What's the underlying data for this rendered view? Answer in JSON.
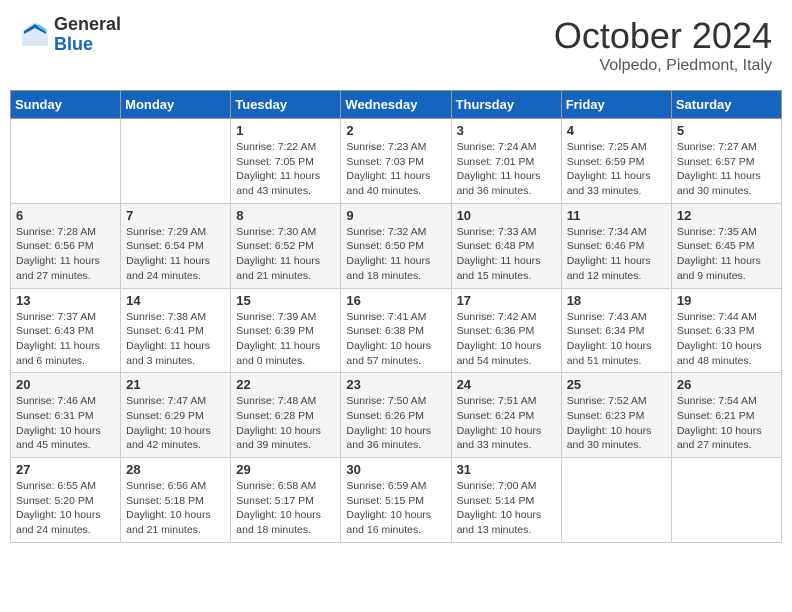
{
  "header": {
    "logo_general": "General",
    "logo_blue": "Blue",
    "month_title": "October 2024",
    "location": "Volpedo, Piedmont, Italy"
  },
  "calendar": {
    "days_of_week": [
      "Sunday",
      "Monday",
      "Tuesday",
      "Wednesday",
      "Thursday",
      "Friday",
      "Saturday"
    ],
    "weeks": [
      [
        {
          "day": "",
          "info": ""
        },
        {
          "day": "",
          "info": ""
        },
        {
          "day": "1",
          "info": "Sunrise: 7:22 AM\nSunset: 7:05 PM\nDaylight: 11 hours and 43 minutes."
        },
        {
          "day": "2",
          "info": "Sunrise: 7:23 AM\nSunset: 7:03 PM\nDaylight: 11 hours and 40 minutes."
        },
        {
          "day": "3",
          "info": "Sunrise: 7:24 AM\nSunset: 7:01 PM\nDaylight: 11 hours and 36 minutes."
        },
        {
          "day": "4",
          "info": "Sunrise: 7:25 AM\nSunset: 6:59 PM\nDaylight: 11 hours and 33 minutes."
        },
        {
          "day": "5",
          "info": "Sunrise: 7:27 AM\nSunset: 6:57 PM\nDaylight: 11 hours and 30 minutes."
        }
      ],
      [
        {
          "day": "6",
          "info": "Sunrise: 7:28 AM\nSunset: 6:56 PM\nDaylight: 11 hours and 27 minutes."
        },
        {
          "day": "7",
          "info": "Sunrise: 7:29 AM\nSunset: 6:54 PM\nDaylight: 11 hours and 24 minutes."
        },
        {
          "day": "8",
          "info": "Sunrise: 7:30 AM\nSunset: 6:52 PM\nDaylight: 11 hours and 21 minutes."
        },
        {
          "day": "9",
          "info": "Sunrise: 7:32 AM\nSunset: 6:50 PM\nDaylight: 11 hours and 18 minutes."
        },
        {
          "day": "10",
          "info": "Sunrise: 7:33 AM\nSunset: 6:48 PM\nDaylight: 11 hours and 15 minutes."
        },
        {
          "day": "11",
          "info": "Sunrise: 7:34 AM\nSunset: 6:46 PM\nDaylight: 11 hours and 12 minutes."
        },
        {
          "day": "12",
          "info": "Sunrise: 7:35 AM\nSunset: 6:45 PM\nDaylight: 11 hours and 9 minutes."
        }
      ],
      [
        {
          "day": "13",
          "info": "Sunrise: 7:37 AM\nSunset: 6:43 PM\nDaylight: 11 hours and 6 minutes."
        },
        {
          "day": "14",
          "info": "Sunrise: 7:38 AM\nSunset: 6:41 PM\nDaylight: 11 hours and 3 minutes."
        },
        {
          "day": "15",
          "info": "Sunrise: 7:39 AM\nSunset: 6:39 PM\nDaylight: 11 hours and 0 minutes."
        },
        {
          "day": "16",
          "info": "Sunrise: 7:41 AM\nSunset: 6:38 PM\nDaylight: 10 hours and 57 minutes."
        },
        {
          "day": "17",
          "info": "Sunrise: 7:42 AM\nSunset: 6:36 PM\nDaylight: 10 hours and 54 minutes."
        },
        {
          "day": "18",
          "info": "Sunrise: 7:43 AM\nSunset: 6:34 PM\nDaylight: 10 hours and 51 minutes."
        },
        {
          "day": "19",
          "info": "Sunrise: 7:44 AM\nSunset: 6:33 PM\nDaylight: 10 hours and 48 minutes."
        }
      ],
      [
        {
          "day": "20",
          "info": "Sunrise: 7:46 AM\nSunset: 6:31 PM\nDaylight: 10 hours and 45 minutes."
        },
        {
          "day": "21",
          "info": "Sunrise: 7:47 AM\nSunset: 6:29 PM\nDaylight: 10 hours and 42 minutes."
        },
        {
          "day": "22",
          "info": "Sunrise: 7:48 AM\nSunset: 6:28 PM\nDaylight: 10 hours and 39 minutes."
        },
        {
          "day": "23",
          "info": "Sunrise: 7:50 AM\nSunset: 6:26 PM\nDaylight: 10 hours and 36 minutes."
        },
        {
          "day": "24",
          "info": "Sunrise: 7:51 AM\nSunset: 6:24 PM\nDaylight: 10 hours and 33 minutes."
        },
        {
          "day": "25",
          "info": "Sunrise: 7:52 AM\nSunset: 6:23 PM\nDaylight: 10 hours and 30 minutes."
        },
        {
          "day": "26",
          "info": "Sunrise: 7:54 AM\nSunset: 6:21 PM\nDaylight: 10 hours and 27 minutes."
        }
      ],
      [
        {
          "day": "27",
          "info": "Sunrise: 6:55 AM\nSunset: 5:20 PM\nDaylight: 10 hours and 24 minutes."
        },
        {
          "day": "28",
          "info": "Sunrise: 6:56 AM\nSunset: 5:18 PM\nDaylight: 10 hours and 21 minutes."
        },
        {
          "day": "29",
          "info": "Sunrise: 6:58 AM\nSunset: 5:17 PM\nDaylight: 10 hours and 18 minutes."
        },
        {
          "day": "30",
          "info": "Sunrise: 6:59 AM\nSunset: 5:15 PM\nDaylight: 10 hours and 16 minutes."
        },
        {
          "day": "31",
          "info": "Sunrise: 7:00 AM\nSunset: 5:14 PM\nDaylight: 10 hours and 13 minutes."
        },
        {
          "day": "",
          "info": ""
        },
        {
          "day": "",
          "info": ""
        }
      ]
    ]
  }
}
